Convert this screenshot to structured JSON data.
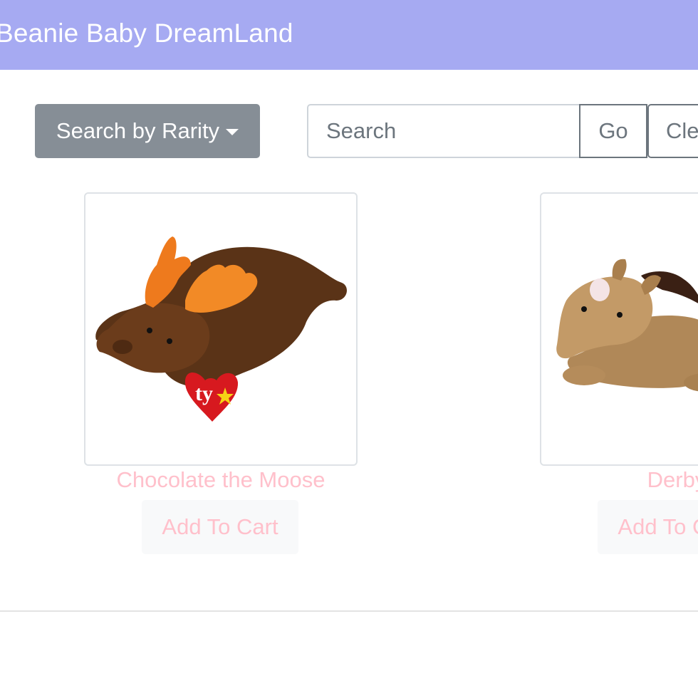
{
  "header": {
    "title": "Beanie Baby DreamLand",
    "background": "#a6aaf2"
  },
  "controls": {
    "rarity_label": "Search by Rarity",
    "search_placeholder": "Search",
    "search_value": "",
    "go_label": "Go",
    "clear_label": "Clear"
  },
  "products": [
    {
      "name": "Chocolate the Moose",
      "cart_label": "Add To Cart",
      "image_icon": "moose-plush-image",
      "tag_text": "ty"
    },
    {
      "name": "Derby",
      "cart_label": "Add To Cart",
      "image_icon": "horse-plush-image"
    }
  ],
  "colors": {
    "accent_pink": "#ffc0cb",
    "secondary_gray": "#868e96"
  }
}
